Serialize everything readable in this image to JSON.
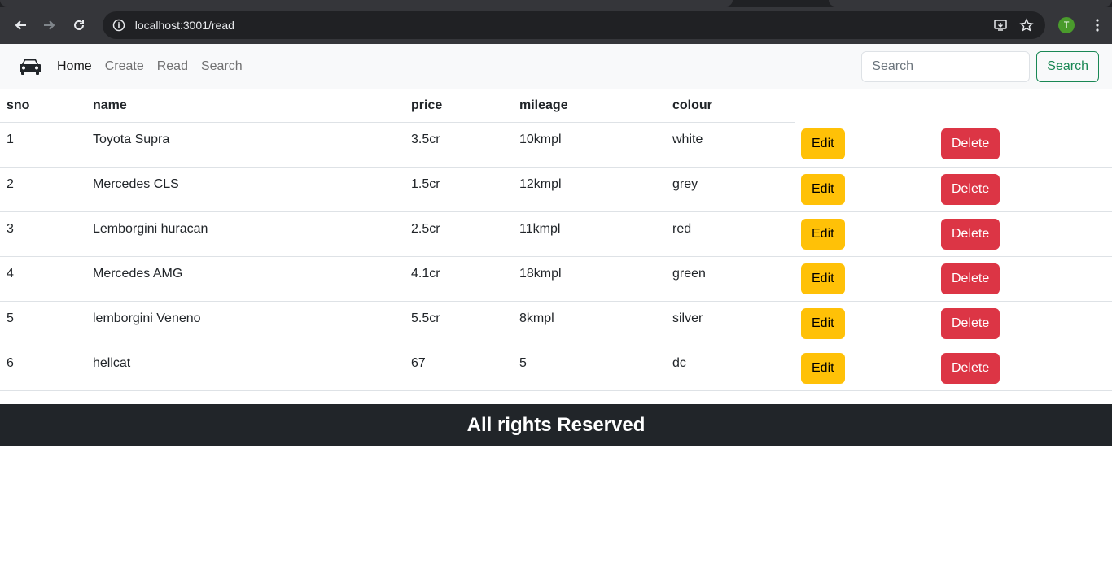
{
  "browser": {
    "url": "localhost:3001/read",
    "profile_initial": "T"
  },
  "navbar": {
    "links": [
      "Home",
      "Create",
      "Read",
      "Search"
    ],
    "active_link": "Home",
    "search_placeholder": "Search",
    "search_button": "Search"
  },
  "table": {
    "headers": [
      "sno",
      "name",
      "price",
      "mileage",
      "colour"
    ],
    "edit_label": "Edit",
    "delete_label": "Delete",
    "rows": [
      {
        "sno": "1",
        "name": "Toyota Supra",
        "price": "3.5cr",
        "mileage": "10kmpl",
        "colour": "white"
      },
      {
        "sno": "2",
        "name": "Mercedes CLS",
        "price": "1.5cr",
        "mileage": "12kmpl",
        "colour": "grey"
      },
      {
        "sno": "3",
        "name": "Lemborgini huracan",
        "price": "2.5cr",
        "mileage": "11kmpl",
        "colour": "red"
      },
      {
        "sno": "4",
        "name": "Mercedes AMG",
        "price": "4.1cr",
        "mileage": "18kmpl",
        "colour": "green"
      },
      {
        "sno": "5",
        "name": "lemborgini Veneno",
        "price": "5.5cr",
        "mileage": "8kmpl",
        "colour": "silver"
      },
      {
        "sno": "6",
        "name": "hellcat",
        "price": "67",
        "mileage": "5",
        "colour": "dc"
      }
    ]
  },
  "footer": {
    "text": "All rights Reserved"
  },
  "colors": {
    "edit": "#ffc107",
    "delete": "#dc3545",
    "search_outline": "#198754",
    "footer_bg": "#212529"
  }
}
